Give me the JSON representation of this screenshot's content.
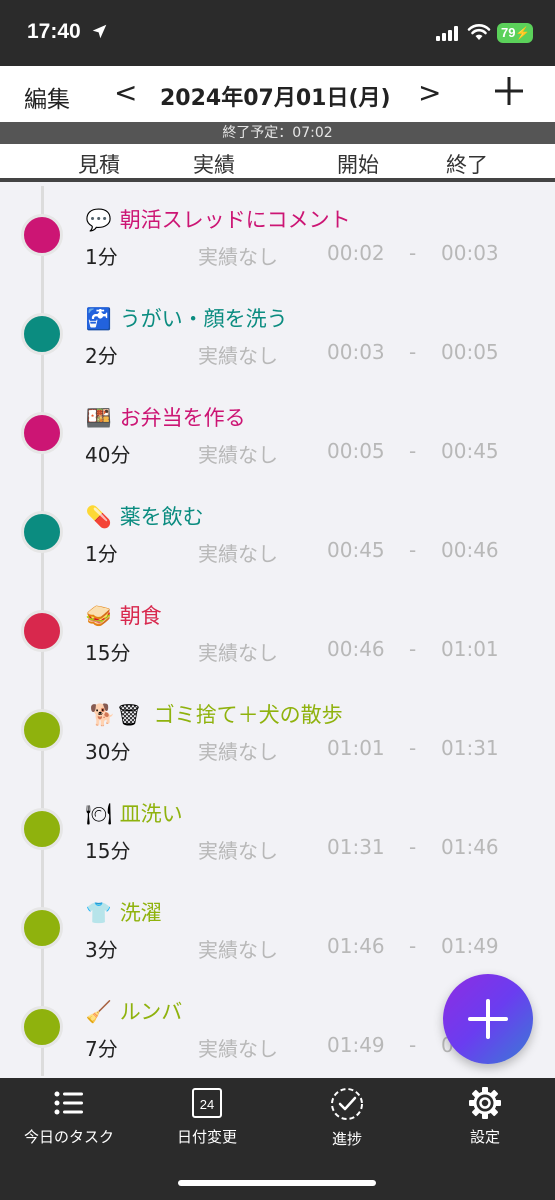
{
  "status_bar": {
    "time": "17:40",
    "battery": "79"
  },
  "nav": {
    "edit_label": "編集",
    "prev_label": "<",
    "date": "2024年07月01日(月)",
    "next_label": ">"
  },
  "end_banner": "終了予定：07:02",
  "columns": {
    "estimate": "見積",
    "actual": "実績",
    "start": "開始",
    "end": "終了"
  },
  "colors": {
    "magenta": "#cc1574",
    "teal": "#0b8c80",
    "crimson": "#d8284d",
    "lime": "#8fb20d"
  },
  "tasks": [
    {
      "emoji": "💬",
      "title": "朝活スレッドにコメント",
      "estimate": "1分",
      "actual": "実績なし",
      "start": "00:02",
      "dash": "-",
      "end": "00:03",
      "color": "#cc1574"
    },
    {
      "emoji": "🚰",
      "title": "うがい・顔を洗う",
      "estimate": "2分",
      "actual": "実績なし",
      "start": "00:03",
      "dash": "-",
      "end": "00:05",
      "color": "#0b8c80"
    },
    {
      "emoji": "🍱",
      "title": "お弁当を作る",
      "estimate": "40分",
      "actual": "実績なし",
      "start": "00:05",
      "dash": "-",
      "end": "00:45",
      "color": "#cc1574"
    },
    {
      "emoji": "💊",
      "title": "薬を飲む",
      "estimate": "1分",
      "actual": "実績なし",
      "start": "00:45",
      "dash": "-",
      "end": "00:46",
      "color": "#0b8c80"
    },
    {
      "emoji": "🥪",
      "title": "朝食",
      "estimate": "15分",
      "actual": "実績なし",
      "start": "00:46",
      "dash": "-",
      "end": "01:01",
      "color": "#d8284d"
    },
    {
      "emoji": "🐕🗑",
      "title": "ゴミ捨て＋犬の散歩",
      "estimate": "30分",
      "actual": "実績なし",
      "start": "01:01",
      "dash": "-",
      "end": "01:31",
      "color": "#8fb20d"
    },
    {
      "emoji": "🍽",
      "title": "皿洗い",
      "estimate": "15分",
      "actual": "実績なし",
      "start": "01:31",
      "dash": "-",
      "end": "01:46",
      "color": "#8fb20d"
    },
    {
      "emoji": "👕",
      "title": "洗濯",
      "estimate": "3分",
      "actual": "実績なし",
      "start": "01:46",
      "dash": "-",
      "end": "01:49",
      "color": "#8fb20d"
    },
    {
      "emoji": "🧹",
      "title": "ルンバ",
      "estimate": "7分",
      "actual": "実績なし",
      "start": "01:49",
      "dash": "-",
      "end": "0",
      "color": "#8fb20d"
    }
  ],
  "tabs": [
    {
      "label": "今日のタスク",
      "icon": "list-icon"
    },
    {
      "label": "日付変更",
      "icon": "calendar-icon",
      "calendar_day": "24"
    },
    {
      "label": "進捗",
      "icon": "progress-check-icon"
    },
    {
      "label": "設定",
      "icon": "gear-icon"
    }
  ]
}
